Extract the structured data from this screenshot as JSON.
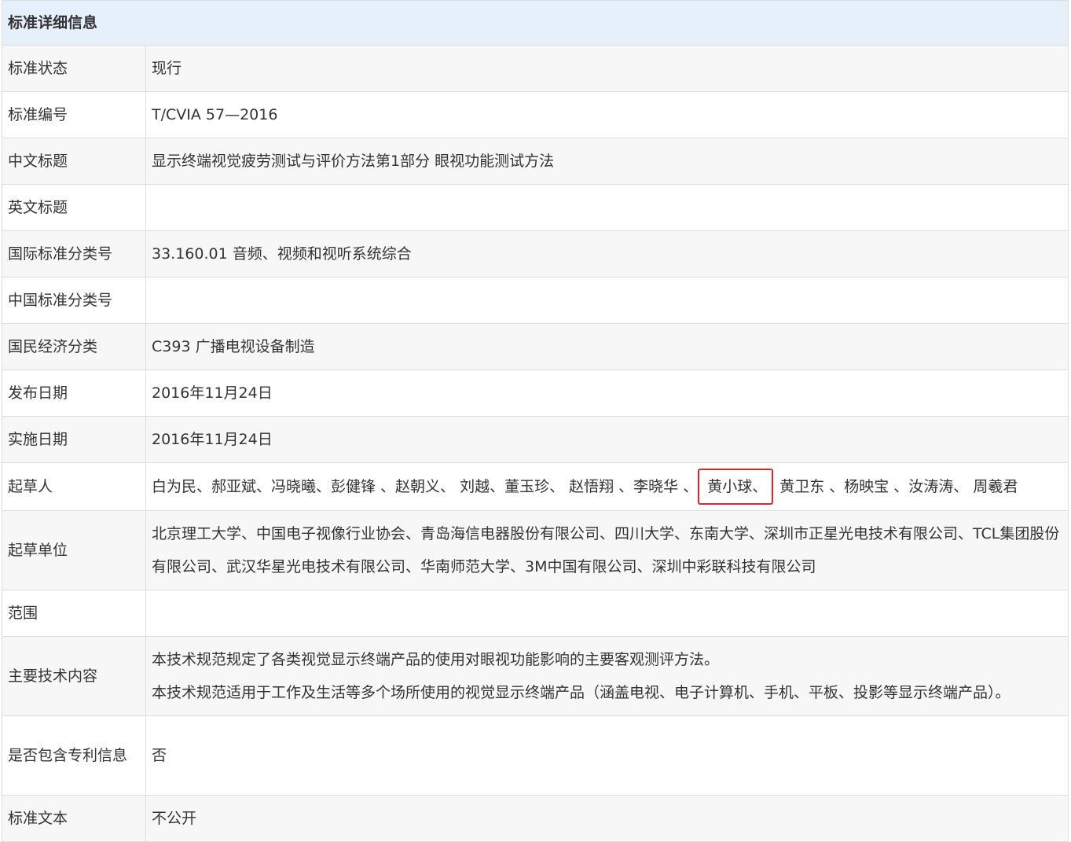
{
  "header": {
    "title": "标准详细信息"
  },
  "rows": {
    "status": {
      "label": "标准状态",
      "value": "现行"
    },
    "number": {
      "label": "标准编号",
      "value": "T/CVIA 57—2016"
    },
    "cn_title": {
      "label": "中文标题",
      "value": "显示终端视觉疲劳测试与评价方法第1部分 眼视功能测试方法"
    },
    "en_title": {
      "label": "英文标题",
      "value": ""
    },
    "ics": {
      "label": "国际标准分类号",
      "value": "33.160.01 音频、视频和视听系统综合"
    },
    "ccs": {
      "label": "中国标准分类号",
      "value": ""
    },
    "industry": {
      "label": "国民经济分类",
      "value": "C393 广播电视设备制造"
    },
    "publish_date": {
      "label": "发布日期",
      "value": "2016年11月24日"
    },
    "impl_date": {
      "label": "实施日期",
      "value": "2016年11月24日"
    },
    "drafters": {
      "label": "起草人",
      "before": "白为民、郝亚斌、冯晓曦、彭健锋 、赵朝义、 刘越、董玉珍、 赵悟翔 、李晓华 、",
      "highlighted": "黄小球、",
      "after": "黄卫东 、杨映宝 、汝涛涛、 周羲君"
    },
    "units": {
      "label": "起草单位",
      "value": "北京理工大学、中国电子视像行业协会、青岛海信电器股份有限公司、四川大学、东南大学、深圳市正星光电技术有限公司、TCL集团股份有限公司、武汉华星光电技术有限公司、华南师范大学、3M中国有限公司、深圳中彩联科技有限公司"
    },
    "scope": {
      "label": "范围",
      "value": ""
    },
    "tech": {
      "label": "主要技术内容",
      "line1": "本技术规范规定了各类视觉显示终端产品的使用对眼视功能影响的主要客观测评方法。",
      "line2": "本技术规范适用于工作及生活等多个场所使用的视觉显示终端产品（涵盖电视、电子计算机、手机、平板、投影等显示终端产品）。"
    },
    "patent": {
      "label": "是否包含专利信息",
      "value": "否"
    },
    "text": {
      "label": "标准文本",
      "value": "不公开"
    }
  },
  "colors": {
    "header_bg": "#e6f0fb",
    "border": "#dddddd",
    "stripe": "#f7f7f7",
    "highlight_box": "#e0262b"
  }
}
